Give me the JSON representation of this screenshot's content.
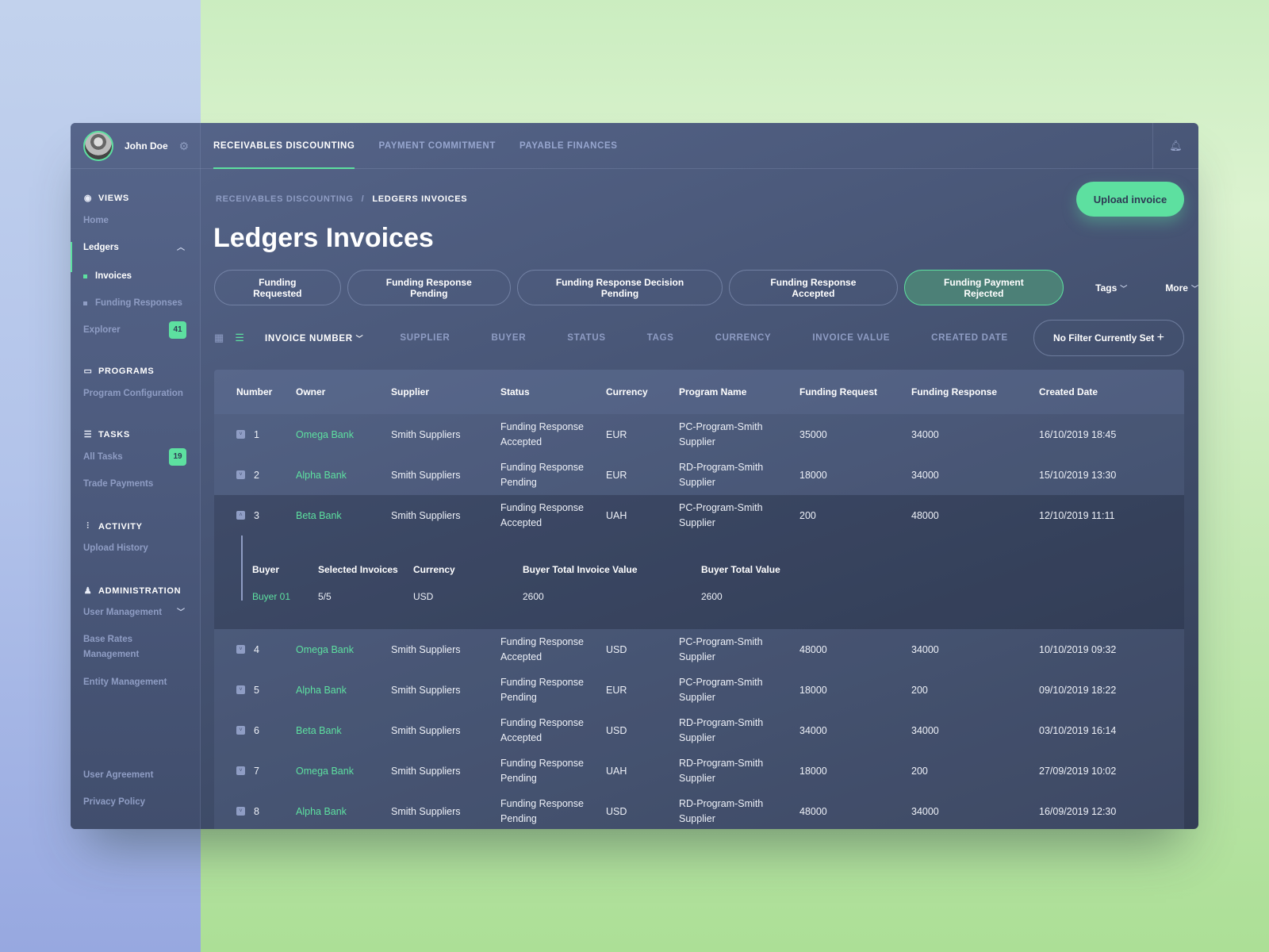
{
  "user": {
    "name": "John Doe"
  },
  "tabs": [
    {
      "label": "RECEIVABLES DISCOUNTING"
    },
    {
      "label": "PAYMENT COMMITMENT"
    },
    {
      "label": "PAYABLE FINANCES"
    }
  ],
  "sidebar": {
    "views": "VIEWS",
    "home": "Home",
    "ledgers": "Ledgers",
    "invoices": "Invoices",
    "funding_responses": "Funding Responses",
    "explorer": "Explorer",
    "explorer_count": "41",
    "programs": "PROGRAMS",
    "program_config": "Program Configuration",
    "tasks": "TASKS",
    "all_tasks": "All Tasks",
    "all_tasks_count": "19",
    "trade_payments": "Trade Payments",
    "activity": "ACTIVITY",
    "upload_history": "Upload History",
    "administration": "ADMINISTRATION",
    "user_management": "User Management",
    "base_rates": "Base Rates Management",
    "entity_management": "Entity Management",
    "user_agreement": "User Agreement",
    "privacy_policy": "Privacy Policy"
  },
  "breadcrumb": {
    "parent": "RECEIVABLES DISCOUNTING",
    "sep": "/",
    "current": "LEDGERS INVOICES"
  },
  "upload_label": "Upload invoice",
  "title": "Ledgers Invoices",
  "chips": [
    "Funding Requested",
    "Funding Response Pending",
    "Funding Response Decision Pending",
    "Funding Response Accepted",
    "Funding Payment Rejected"
  ],
  "tags_label": "Tags",
  "more_label": "More",
  "filter_cols": [
    "INVOICE NUMBER",
    "SUPPLIER",
    "BUYER",
    "STATUS",
    "TAGS",
    "CURRENCY",
    "INVOICE VALUE",
    "CREATED DATE"
  ],
  "no_filter": "No Filter Currently Set",
  "columns": [
    "Number",
    "Owner",
    "Supplier",
    "Status",
    "Currency",
    "Program Name",
    "Funding Request",
    "Funding Response",
    "Created Date"
  ],
  "rows": [
    {
      "n": "1",
      "owner": "Omega Bank",
      "supplier": "Smith Suppliers",
      "status": "Funding Response Accepted",
      "cur": "EUR",
      "program": "PC-Program-Smith Supplier",
      "req": "35000",
      "resp": "34000",
      "date": "16/10/2019 18:45"
    },
    {
      "n": "2",
      "owner": "Alpha Bank",
      "supplier": "Smith Suppliers",
      "status": "Funding Response Pending",
      "cur": "EUR",
      "program": "RD-Program-Smith Supplier",
      "req": "18000",
      "resp": "34000",
      "date": "15/10/2019 13:30"
    },
    {
      "n": "3",
      "owner": "Beta Bank",
      "supplier": "Smith Suppliers",
      "status": "Funding Response Accepted",
      "cur": "UAH",
      "program": "PC-Program-Smith Supplier",
      "req": "200",
      "resp": "48000",
      "date": "12/10/2019 11:11"
    },
    {
      "n": "4",
      "owner": "Omega Bank",
      "supplier": "Smith Suppliers",
      "status": "Funding Response Accepted",
      "cur": "USD",
      "program": "PC-Program-Smith Supplier",
      "req": "48000",
      "resp": "34000",
      "date": "10/10/2019 09:32"
    },
    {
      "n": "5",
      "owner": "Alpha Bank",
      "supplier": "Smith Suppliers",
      "status": "Funding Response Pending",
      "cur": "EUR",
      "program": "PC-Program-Smith Supplier",
      "req": "18000",
      "resp": "200",
      "date": "09/10/2019 18:22"
    },
    {
      "n": "6",
      "owner": "Beta Bank",
      "supplier": "Smith Suppliers",
      "status": "Funding Response Accepted",
      "cur": "USD",
      "program": "RD-Program-Smith Supplier",
      "req": "34000",
      "resp": "34000",
      "date": "03/10/2019 16:14"
    },
    {
      "n": "7",
      "owner": "Omega Bank",
      "supplier": "Smith Suppliers",
      "status": "Funding Response Pending",
      "cur": "UAH",
      "program": "RD-Program-Smith Supplier",
      "req": "18000",
      "resp": "200",
      "date": "27/09/2019 10:02"
    },
    {
      "n": "8",
      "owner": "Alpha Bank",
      "supplier": "Smith Suppliers",
      "status": "Funding Response Pending",
      "cur": "USD",
      "program": "RD-Program-Smith Supplier",
      "req": "48000",
      "resp": "34000",
      "date": "16/09/2019 12:30"
    }
  ],
  "detail": {
    "headers": [
      "Buyer",
      "Selected Invoices",
      "Currency",
      "Buyer Total Invoice Value",
      "Buyer Total Value"
    ],
    "values": [
      "Buyer 01",
      "5/5",
      "USD",
      "2600",
      "2600"
    ]
  },
  "colors": {
    "accent": "#5de0a0"
  }
}
